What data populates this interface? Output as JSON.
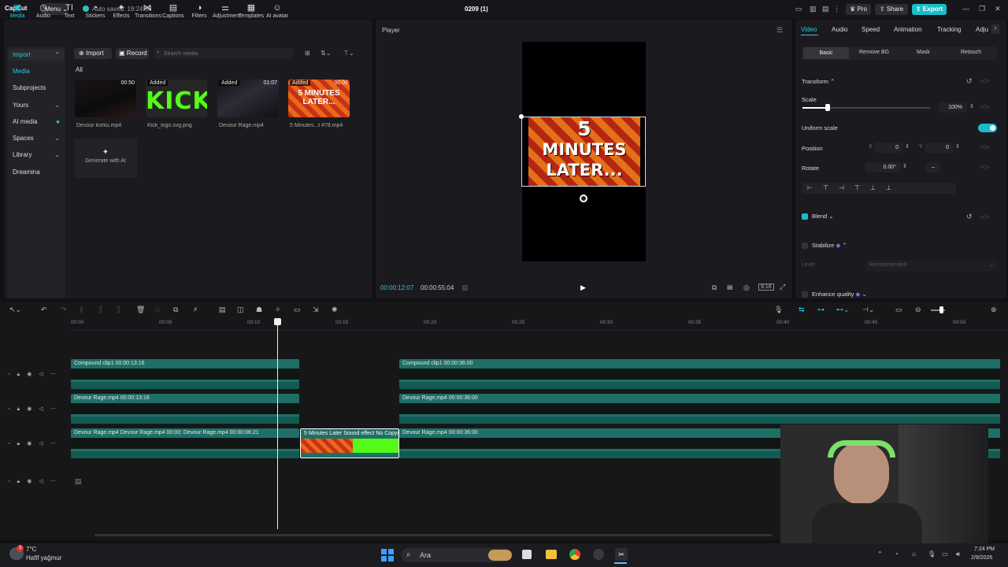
{
  "app": {
    "logo": "CapCut",
    "menu_label": "Menu",
    "autosave": "Auto saved: 19:24:56",
    "project_name": "0209 (1)",
    "pro_label": "Pro",
    "share_label": "Share",
    "export_label": "Export"
  },
  "media_toolbar": {
    "tabs": [
      {
        "label": "Media",
        "icon": "media-icon",
        "glyph": "▣"
      },
      {
        "label": "Audio",
        "icon": "audio-icon",
        "glyph": "◷"
      },
      {
        "label": "Text",
        "icon": "text-icon",
        "glyph": "TI"
      },
      {
        "label": "Stickers",
        "icon": "sticker-icon",
        "glyph": "◔"
      },
      {
        "label": "Effects",
        "icon": "effects-icon",
        "glyph": "✦"
      },
      {
        "label": "Transitions",
        "icon": "transition-icon",
        "glyph": "⋈"
      },
      {
        "label": "Captions",
        "icon": "captions-icon",
        "glyph": "▤"
      },
      {
        "label": "Filters",
        "icon": "filters-icon",
        "glyph": "◑"
      },
      {
        "label": "Adjustment",
        "icon": "adjustment-icon",
        "glyph": "⚌"
      },
      {
        "label": "Templates",
        "icon": "templates-icon",
        "glyph": "▦"
      },
      {
        "label": "AI avatar",
        "icon": "ai-avatar-icon",
        "glyph": "☺"
      }
    ]
  },
  "sidebar": {
    "import": "Import",
    "media": "Media",
    "subprojects": "Subprojects",
    "yours": "Yours",
    "ai_media": "AI media",
    "spaces": "Spaces",
    "library": "Library",
    "dreamina": "Dreamina"
  },
  "media": {
    "import_label": "Import",
    "record_label": "Record",
    "search_placeholder": "Search media",
    "all_label": "All",
    "items": [
      {
        "name": "Devour korku.mp4",
        "badge": "",
        "duration": "00:50"
      },
      {
        "name": "Kick_logo.svg.png",
        "badge": "Added",
        "duration": "",
        "logo_text": "KICK"
      },
      {
        "name": "Devour Rage.mp4",
        "badge": "Added",
        "duration": "01:07"
      },
      {
        "name": "5 Minutes...t #78.mp4",
        "badge": "Added",
        "duration": "00:06",
        "overlay_text": "5 MINUTES LATER..."
      }
    ],
    "generate_ai": "Generate with AI"
  },
  "player": {
    "title": "Player",
    "overlay_text_1": "5",
    "overlay_text_2": "MINUTES",
    "overlay_text_3": "LATER...",
    "current_time": "00:00:12:07",
    "total_time": "00:00:55:04"
  },
  "properties": {
    "tabs": [
      "Video",
      "Audio",
      "Speed",
      "Animation",
      "Tracking",
      "Adju"
    ],
    "subtabs": [
      "Basic",
      "Remove BG",
      "Mask",
      "Retouch"
    ],
    "transform_label": "Transform",
    "scale_label": "Scale",
    "scale_value": "100%",
    "scale_fraction": 0.2,
    "uniform_scale_label": "Uniform scale",
    "position_label": "Position",
    "x_label": "X",
    "x_value": "0",
    "y_label": "Y",
    "y_value": "0",
    "rotate_label": "Rotate",
    "rotate_value": "0.00°",
    "blend_label": "Blend",
    "stabilize_label": "Stabilize",
    "level_label": "Level",
    "level_value": "Recommended",
    "enhance_label": "Enhance quality"
  },
  "timeline": {
    "ruler": [
      "00:00",
      "00:05",
      "00:10",
      "00:15",
      "00:20",
      "00:25",
      "00:30",
      "00:35",
      "00:40",
      "00:45",
      "00:50"
    ],
    "tracks": [
      {
        "clips": [
          {
            "label": "Compound clip1   00:00:13:16"
          },
          {
            "label": "Compound clip1   00:00:36:00"
          }
        ]
      },
      {
        "clips": [
          {
            "label": "Devour Rage.mp4   00:00:13:16"
          },
          {
            "label": "Devour Rage.mp4   00:00:36:00"
          }
        ]
      },
      {
        "clips": [
          {
            "label": "Devour Rage.mp4    Devour Rage.mp4   00:00:    Devour Rage.mp4   00:00:06:21"
          },
          {
            "label": "5 Minutes Later Sound effect No Copyr"
          },
          {
            "label": "Devour Rage.mp4   00:00:36:00"
          }
        ]
      }
    ]
  },
  "taskbar": {
    "weather_temp": "7°C",
    "weather_desc": "Hafif yağmur",
    "search_label": "Ara",
    "time": "7:24 PM",
    "date": "2/9/2026"
  },
  "colors": {
    "accent": "#27c7e0",
    "export": "#1bbcc8",
    "clip": "#1e6f66",
    "kick_green": "#53fc18"
  }
}
